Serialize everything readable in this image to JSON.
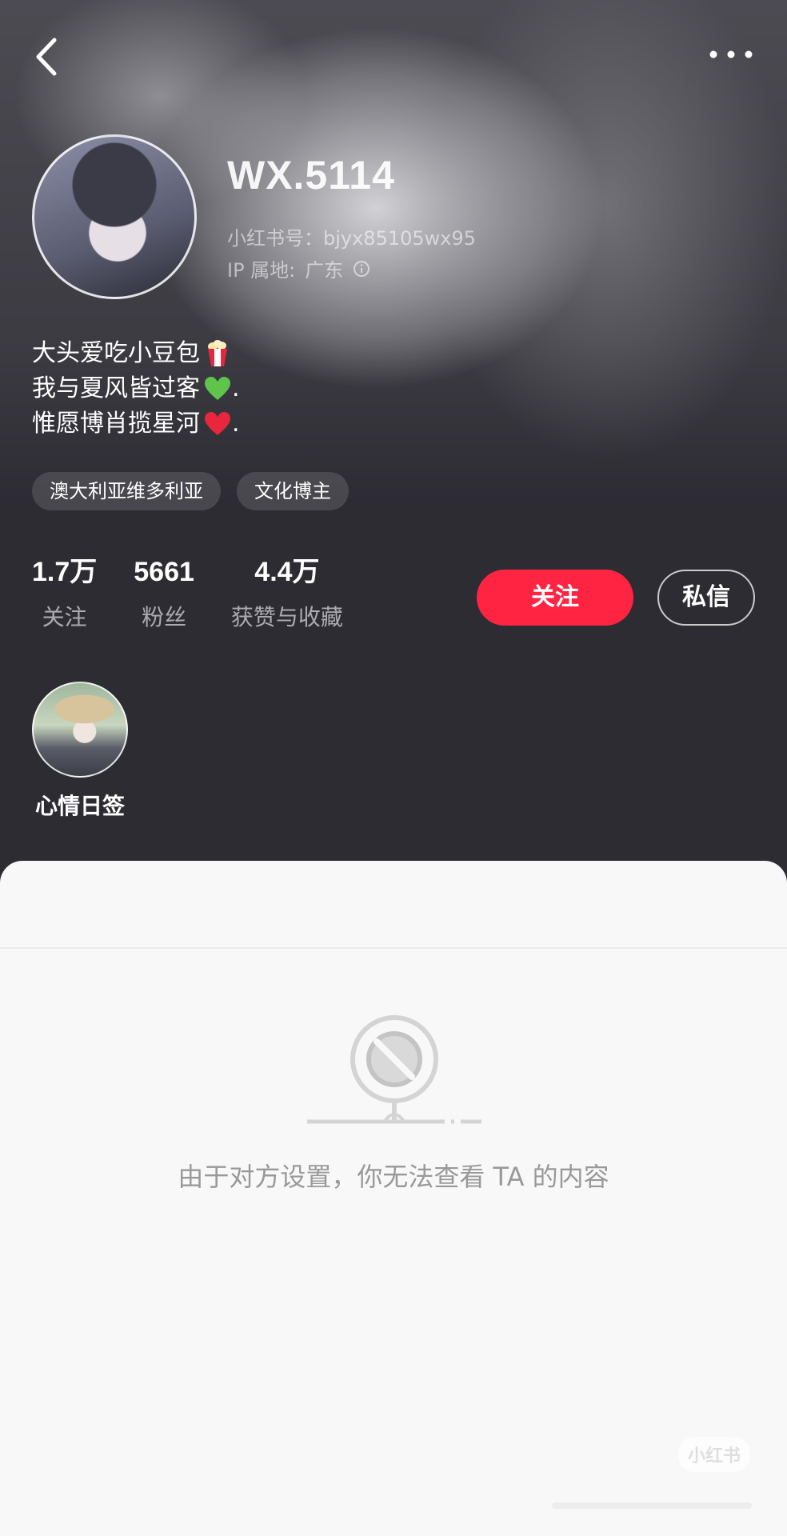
{
  "profile": {
    "name": "WX.5114",
    "id_label": "小红书号：",
    "id_value": "bjyx85105wx95",
    "ip_label": "IP 属地:",
    "ip_value": "广东"
  },
  "bio": {
    "lines": [
      {
        "text": "大头爱吃小豆包",
        "emoji": "popcorn-emoji",
        "suffix": ""
      },
      {
        "text": "我与夏风皆过客",
        "emoji": "green-heart-emoji",
        "suffix": "."
      },
      {
        "text": "惟愿博肖揽星河",
        "emoji": "red-heart-emoji",
        "suffix": "."
      }
    ]
  },
  "tags": [
    "澳大利亚维多利亚",
    "文化博主"
  ],
  "stats": [
    {
      "value": "1.7万",
      "label": "关注"
    },
    {
      "value": "5661",
      "label": "粉丝"
    },
    {
      "value": "4.4万",
      "label": "获赞与收藏"
    }
  ],
  "actions": {
    "follow": "关注",
    "message": "私信"
  },
  "highlight": {
    "label": "心情日签"
  },
  "content": {
    "empty_text": "由于对方设置，你无法查看 TA 的内容"
  },
  "watermark": "小红书",
  "colors": {
    "accent": "#ff2442",
    "background": "#2d2c33",
    "panel": "#f8f8f8"
  }
}
